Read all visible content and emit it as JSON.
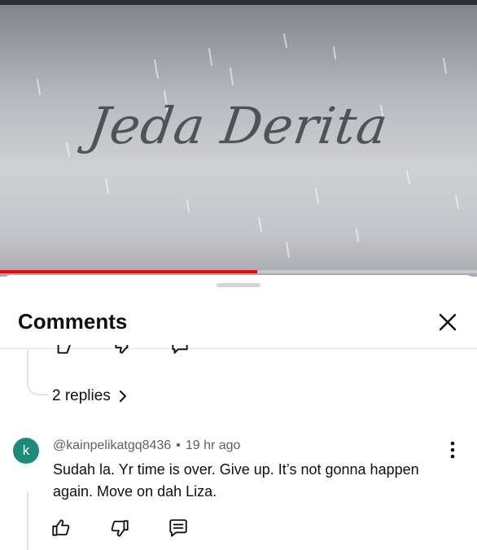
{
  "video": {
    "title_overlay": "Jeda Derita",
    "progress_fraction": 0.54,
    "progress_color": "#ff0000"
  },
  "sheet": {
    "title": "Comments",
    "close_icon": "close-icon"
  },
  "thread": {
    "replies_label": "2 replies",
    "replies_icon": "chevron-right-icon"
  },
  "comment": {
    "avatar_letter": "k",
    "avatar_color": "#1e8a7a",
    "author": "@kainpelikatgq8436",
    "separator": "•",
    "time": "19 hr ago",
    "text": "Sudah la. Yr time is over. Give up. It’s not gonna happen again. Move on dah Liza.",
    "actions": [
      "like-icon",
      "dislike-icon",
      "reply-icon"
    ],
    "menu_icon": "more-vert-icon"
  }
}
